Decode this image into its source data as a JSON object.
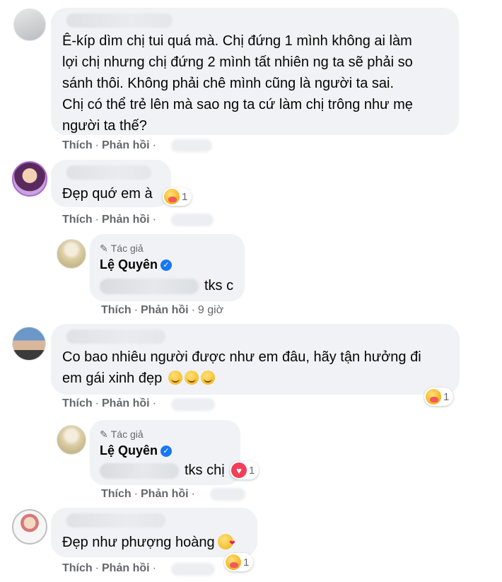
{
  "comments": [
    {
      "text_lines": [
        "Ê-kíp dìm chị tui quá mà. Chị đứng 1 mình không ai làm",
        "lợi chị nhưng chị đứng 2 mình tất nhiên ng ta sẽ phải so",
        "sánh thôi. Không phải chê mình cũng là người ta sai.",
        "Chị có thể trẻ lên mà sao ng ta cứ làm chị trông như mẹ",
        "người ta thế?"
      ],
      "like": "Thích",
      "reply": "Phản hồi"
    },
    {
      "text": "Đẹp quớ em à",
      "like": "Thích",
      "reply": "Phản hồi",
      "reaction_count": "1"
    },
    {
      "text_lines": [
        "Co bao nhiêu người được như em đâu, hãy tận hưởng đi",
        "em gái xinh đẹp"
      ],
      "like": "Thích",
      "reply": "Phản hồi",
      "reaction_count": "1"
    },
    {
      "text": "Đẹp như phượng hoàng",
      "like": "Thích",
      "reply": "Phản hồi",
      "reaction_count": "1"
    }
  ],
  "replies": [
    {
      "author_tag": "Tác giả",
      "author": "Lệ Quyên",
      "text": "tks c",
      "like": "Thích",
      "reply": "Phản hồi",
      "time": "9 giờ"
    },
    {
      "author_tag": "Tác giả",
      "author": "Lệ Quyên",
      "text": "tks chị",
      "like": "Thích",
      "reply": "Phản hồi",
      "reaction_count": "1"
    }
  ],
  "separator": "·",
  "icons": {
    "verified": "✓",
    "pen": "✎",
    "heart": "♥"
  },
  "colors": {
    "bubble": "#f0f2f5",
    "verified": "#1877f2",
    "action_text": "#65676b",
    "love": "#f33e58"
  }
}
